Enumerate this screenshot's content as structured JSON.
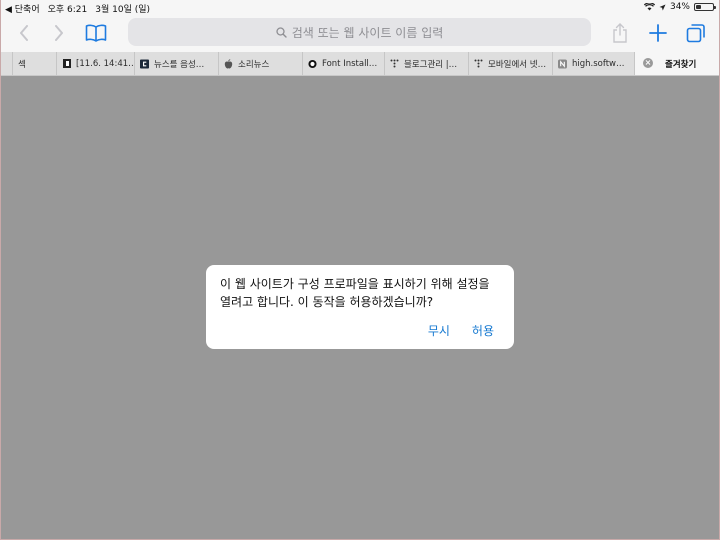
{
  "status_bar": {
    "back_app": "◀ 단축어",
    "time": "오후 6:21",
    "date": "3월 10일 (일)",
    "battery": "34%",
    "battery_level": 0.34
  },
  "toolbar": {
    "address_placeholder": "검색 또는 웹 사이트 이름 입력"
  },
  "tabs": [
    {
      "label": "섹",
      "fav_icon": "blank"
    },
    {
      "label": "[11.6. 14:41…",
      "fav_icon": "dark-square-icon"
    },
    {
      "label": "뉴스를 음성…",
      "fav_icon": "c-logo-icon"
    },
    {
      "label": "소리뉴스",
      "fav_icon": "apple-icon"
    },
    {
      "label": "Font Install…",
      "fav_icon": "ring-icon"
    },
    {
      "label": "블로그관리 |…",
      "fav_icon": "t-logo-icon"
    },
    {
      "label": "모바일에서 넷…",
      "fav_icon": "t-logo-icon"
    },
    {
      "label": "high.softw…",
      "fav_icon": "n-logo-icon"
    },
    {
      "label": "즐겨찾기",
      "fav_icon": "close-icon"
    }
  ],
  "dialog": {
    "message": "이 웹 사이트가 구성 프로파일을 표시하기 위해 설정을 열려고 합니다. 이 동작을 허용하겠습니까?",
    "ignore_label": "무시",
    "allow_label": "허용"
  },
  "colors": {
    "accent": "#1578d0",
    "backdrop": "#989898"
  }
}
